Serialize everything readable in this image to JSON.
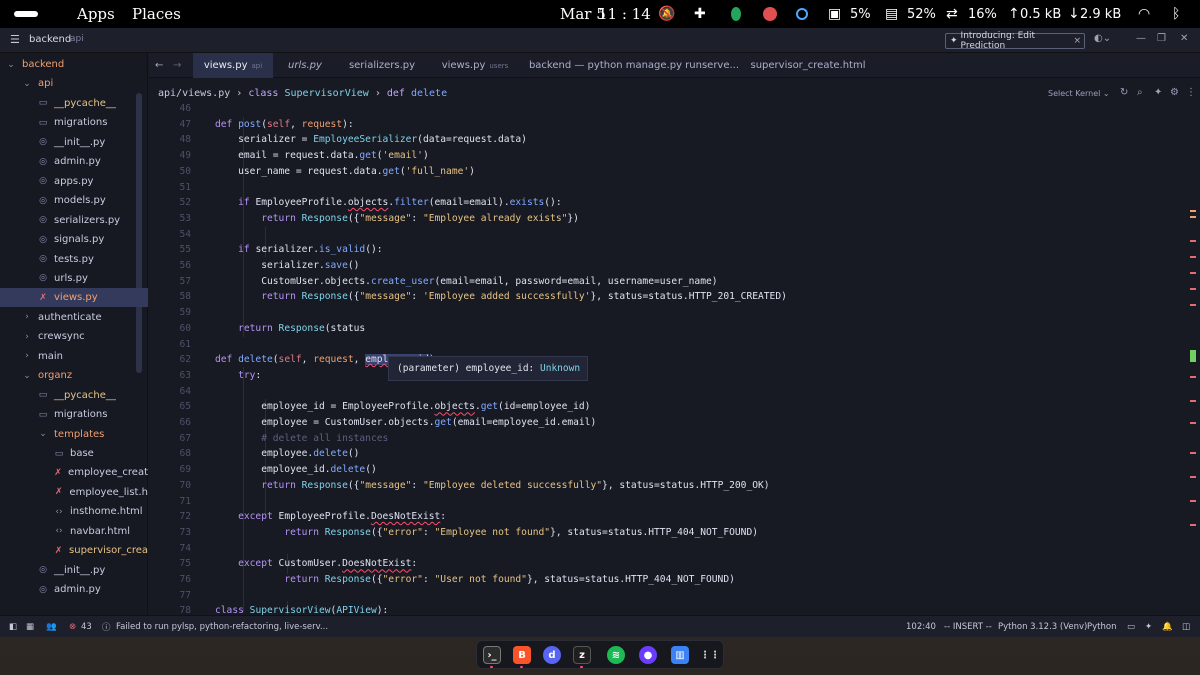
{
  "topbar": {
    "apps": "Apps",
    "places": "Places",
    "date": "Mar 5",
    "time": "11 : 14",
    "cpu": "5%",
    "mem": "52%",
    "swap": "16%",
    "up": "0.5 kB",
    "down": "2.9 kB"
  },
  "titlebar": {
    "project": "backend",
    "sub": "api",
    "intro": "Introducing: Edit Prediction"
  },
  "tree": [
    {
      "label": "backend",
      "indent": 0,
      "icon": "chevron-down-icon",
      "color": "#f0a070"
    },
    {
      "label": "api",
      "indent": 1,
      "icon": "chevron-down-icon",
      "color": "#f0a070"
    },
    {
      "label": "__pycache__",
      "indent": 2,
      "icon": "folder-icon",
      "color": "#e6c384"
    },
    {
      "label": "migrations",
      "indent": 2,
      "icon": "folder-icon",
      "color": "#c8cde0"
    },
    {
      "label": "__init__.py",
      "indent": 2,
      "icon": "python-icon",
      "color": "#c8cde0"
    },
    {
      "label": "admin.py",
      "indent": 2,
      "icon": "python-icon",
      "color": "#c8cde0"
    },
    {
      "label": "apps.py",
      "indent": 2,
      "icon": "python-icon",
      "color": "#c8cde0"
    },
    {
      "label": "models.py",
      "indent": 2,
      "icon": "python-icon",
      "color": "#c8cde0"
    },
    {
      "label": "serializers.py",
      "indent": 2,
      "icon": "python-icon",
      "color": "#c8cde0"
    },
    {
      "label": "signals.py",
      "indent": 2,
      "icon": "python-icon",
      "color": "#c8cde0"
    },
    {
      "label": "tests.py",
      "indent": 2,
      "icon": "python-icon",
      "color": "#c8cde0"
    },
    {
      "label": "urls.py",
      "indent": 2,
      "icon": "python-icon",
      "color": "#c8cde0"
    },
    {
      "label": "views.py",
      "indent": 2,
      "icon": "error-file-icon",
      "color": "#f0a070",
      "active": true
    },
    {
      "label": "authenticate",
      "indent": 1,
      "icon": "chevron-right-icon",
      "color": "#c8cde0"
    },
    {
      "label": "crewsync",
      "indent": 1,
      "icon": "chevron-right-icon",
      "color": "#c8cde0"
    },
    {
      "label": "main",
      "indent": 1,
      "icon": "chevron-right-icon",
      "color": "#c8cde0"
    },
    {
      "label": "organz",
      "indent": 1,
      "icon": "chevron-down-icon",
      "color": "#f0a070"
    },
    {
      "label": "__pycache__",
      "indent": 2,
      "icon": "folder-icon",
      "color": "#e6c384"
    },
    {
      "label": "migrations",
      "indent": 2,
      "icon": "folder-icon",
      "color": "#c8cde0"
    },
    {
      "label": "templates",
      "indent": 2,
      "icon": "chevron-down-icon",
      "color": "#f0a070"
    },
    {
      "label": "base",
      "indent": 3,
      "icon": "folder-icon",
      "color": "#c8cde0"
    },
    {
      "label": "employee_creat",
      "indent": 3,
      "icon": "error-file-icon",
      "color": "#c8cde0"
    },
    {
      "label": "employee_list.h",
      "indent": 3,
      "icon": "error-file-icon",
      "color": "#c8cde0"
    },
    {
      "label": "insthome.html",
      "indent": 3,
      "icon": "html-icon",
      "color": "#c8cde0"
    },
    {
      "label": "navbar.html",
      "indent": 3,
      "icon": "html-icon",
      "color": "#c8cde0"
    },
    {
      "label": "supervisor_crea",
      "indent": 3,
      "icon": "error-file-icon",
      "color": "#e6c384"
    },
    {
      "label": "__init__.py",
      "indent": 2,
      "icon": "python-icon",
      "color": "#c8cde0"
    },
    {
      "label": "admin.py",
      "indent": 2,
      "icon": "python-icon",
      "color": "#c8cde0"
    }
  ],
  "tabs": [
    {
      "label": "views.py",
      "sub": "api",
      "active": true
    },
    {
      "label": "urls.py",
      "sub": ""
    },
    {
      "label": "serializers.py",
      "sub": ""
    },
    {
      "label": "views.py",
      "sub": "users"
    },
    {
      "label": "backend — python manage.py runserve...",
      "sub": ""
    },
    {
      "label": "supervisor_create.html",
      "sub": ""
    }
  ],
  "breadcrumb": {
    "path": "api/views.py",
    "sep1": "›",
    "kw1": "class",
    "cls": "SupervisorView",
    "sep2": "›",
    "kw2": "def",
    "fn": "delete"
  },
  "kernel": "Select Kernel",
  "line_numbers": [
    "46",
    "47",
    "48",
    "49",
    "50",
    "51",
    "52",
    "53",
    "54",
    "55",
    "56",
    "57",
    "58",
    "59",
    "60",
    "61",
    "62",
    "63",
    "64",
    "65",
    "66",
    "67",
    "68",
    "69",
    "70",
    "71",
    "72",
    "73",
    "74",
    "75",
    "76",
    "77",
    "78"
  ],
  "tooltip": {
    "prefix": "(parameter) employee_id: ",
    "type": "Unknown"
  },
  "status": {
    "errors": "43",
    "message": "Failed to run pylsp, python-refactoring, live-serv...",
    "position": "102:40",
    "mode": "-- INSERT --",
    "python": "Python 3.12.3 (Venv)",
    "lang": "Python"
  }
}
